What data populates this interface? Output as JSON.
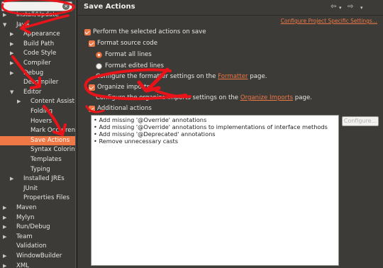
{
  "tree": {
    "filter_placeholder": "type filter text",
    "items": [
      {
        "label": "Install/Update",
        "indent": 0,
        "arrow": "right"
      },
      {
        "label": "Java",
        "indent": 0,
        "arrow": "down"
      },
      {
        "label": "Appearance",
        "indent": 1,
        "arrow": "right"
      },
      {
        "label": "Build Path",
        "indent": 1,
        "arrow": "right"
      },
      {
        "label": "Code Style",
        "indent": 1,
        "arrow": "right"
      },
      {
        "label": "Compiler",
        "indent": 1,
        "arrow": "right"
      },
      {
        "label": "Debug",
        "indent": 1,
        "arrow": "right"
      },
      {
        "label": "Decompiler",
        "indent": 1,
        "arrow": "none"
      },
      {
        "label": "Editor",
        "indent": 1,
        "arrow": "down"
      },
      {
        "label": "Content Assist",
        "indent": 2,
        "arrow": "right"
      },
      {
        "label": "Folding",
        "indent": 2,
        "arrow": "none"
      },
      {
        "label": "Hovers",
        "indent": 2,
        "arrow": "none"
      },
      {
        "label": "Mark Occurrences",
        "indent": 2,
        "arrow": "none"
      },
      {
        "label": "Save Actions",
        "indent": 2,
        "arrow": "none",
        "selected": true
      },
      {
        "label": "Syntax Coloring",
        "indent": 2,
        "arrow": "none"
      },
      {
        "label": "Templates",
        "indent": 2,
        "arrow": "none"
      },
      {
        "label": "Typing",
        "indent": 2,
        "arrow": "none"
      },
      {
        "label": "Installed JREs",
        "indent": 1,
        "arrow": "right"
      },
      {
        "label": "JUnit",
        "indent": 1,
        "arrow": "none"
      },
      {
        "label": "Properties Files",
        "indent": 1,
        "arrow": "none"
      },
      {
        "label": "Maven",
        "indent": 0,
        "arrow": "right"
      },
      {
        "label": "Mylyn",
        "indent": 0,
        "arrow": "right"
      },
      {
        "label": "Run/Debug",
        "indent": 0,
        "arrow": "right"
      },
      {
        "label": "Team",
        "indent": 0,
        "arrow": "right"
      },
      {
        "label": "Validation",
        "indent": 0,
        "arrow": "none"
      },
      {
        "label": "WindowBuilder",
        "indent": 0,
        "arrow": "right"
      },
      {
        "label": "XML",
        "indent": 0,
        "arrow": "right"
      }
    ]
  },
  "page": {
    "title": "Save Actions",
    "configure_link": "Configure Project Specific Settings...",
    "perform_label": "Perform the selected actions on save",
    "format_label": "Format source code",
    "format_all_label": "Format all lines",
    "format_edited_label": "Format edited lines",
    "formatter_note_pre": "Configure the formatter settings on the ",
    "formatter_note_link": "Formatter",
    "formatter_note_post": " page.",
    "organize_label": "Organize imports",
    "organize_note_pre": "Configure the organize imports settings on the ",
    "organize_note_link": "Organize Imports",
    "organize_note_post": " page.",
    "additional_label": "Additional actions",
    "configure_button": "Configure...",
    "actions": [
      "Add missing '@Override' annotations",
      "Add missing '@Override' annotations to implementations of interface methods",
      "Add missing '@Deprecated' annotations",
      "Remove unnecessary casts"
    ]
  },
  "colors": {
    "accent": "#f07746",
    "annotation": "#e8141a",
    "background": "#3c3b37"
  }
}
